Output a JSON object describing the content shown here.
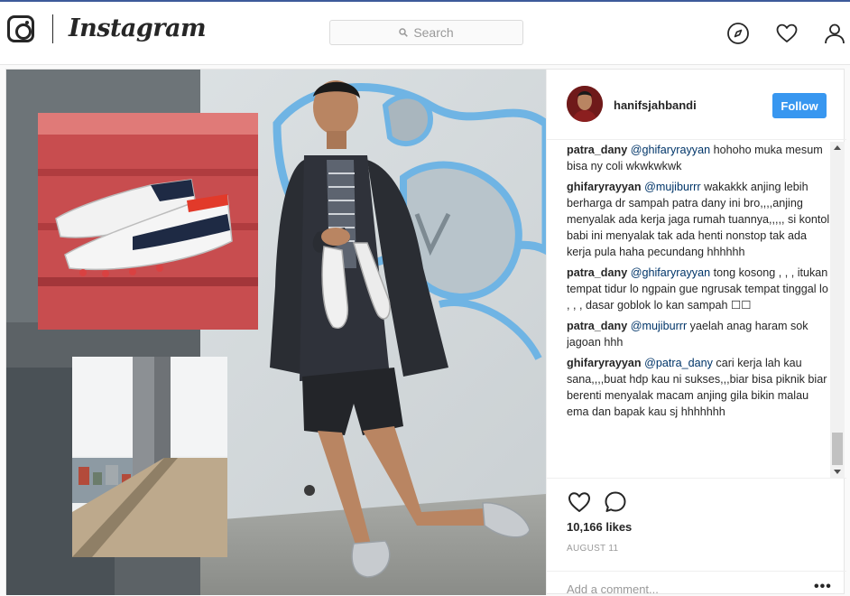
{
  "nav": {
    "brand": "Instagram",
    "search_placeholder": "Search"
  },
  "post": {
    "username": "hanifsjahbandi",
    "follow_label": "Follow",
    "comments": [
      {
        "author": "patra_dany",
        "mention": "@ghifaryrayyan",
        "text": " hohoho muka mesum bisa ny coli wkwkwkwk"
      },
      {
        "author": "ghifaryrayyan",
        "mention": "@mujiburrr",
        "text": " wakakkk anjing lebih berharga dr sampah patra dany ini bro,,,,anjing menyalak ada kerja jaga rumah tuannya,,,,, si kontol babi ini menyalak tak ada henti nonstop tak ada kerja pula haha pecundang hhhhhh"
      },
      {
        "author": "patra_dany",
        "mention": "@ghifaryrayyan",
        "text": " tong kosong , , , itukan tempat tidur lo ngpain gue ngrusak tempat tinggal lo , , , dasar goblok lo kan sampah ☐☐"
      },
      {
        "author": "patra_dany",
        "mention": "@mujiburrr",
        "text": " yaelah anag haram sok jagoan hhh"
      },
      {
        "author": "ghifaryrayyan",
        "mention": "@patra_dany",
        "text": " cari kerja lah kau sana,,,,buat hdp kau ni sukses,,,biar bisa piknik biar berenti menyalak macam anjing gila bikin malau ema dan bapak kau sj hhhhhhh"
      }
    ],
    "likes": "10,166 likes",
    "date": "AUGUST 11",
    "add_comment_placeholder": "Add a comment...",
    "more_label": "•••"
  },
  "colors": {
    "accent": "#3897f0",
    "mention": "#003569",
    "border": "#e6e6e6"
  }
}
